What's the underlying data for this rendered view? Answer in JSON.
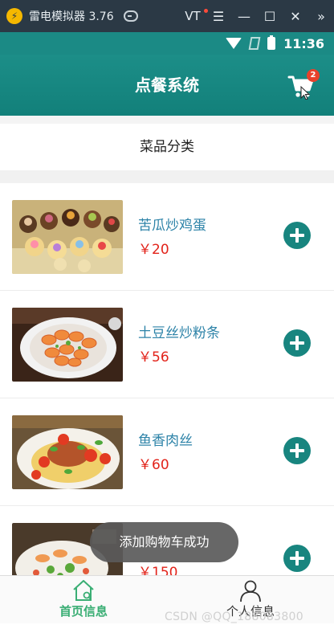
{
  "emulator": {
    "title": "雷电模拟器 3.76",
    "vt_label": "VT",
    "menu_glyph": "☰",
    "minimize_glyph": "—",
    "maximize_glyph": "☐",
    "close_glyph": "✕",
    "expand_glyph": "»"
  },
  "status_bar": {
    "time": "11:36"
  },
  "app": {
    "title": "点餐系统",
    "cart_count": "2"
  },
  "category": {
    "label": "菜品分类"
  },
  "dishes": [
    {
      "name": "苦瓜炒鸡蛋",
      "price": "￥20",
      "image": "desserts-plate"
    },
    {
      "name": "土豆丝炒粉条",
      "price": "￥56",
      "image": "shrimp-plate"
    },
    {
      "name": "鱼香肉丝",
      "price": "￥60",
      "image": "pasta-plate"
    },
    {
      "name": "",
      "price": "￥150",
      "image": "seafood-plate"
    }
  ],
  "toast": {
    "text": "添加购物车成功"
  },
  "bottom_nav": {
    "home_label": "首页信息",
    "profile_label": "个人信息"
  },
  "watermark": "CSDN @QQ_188083800",
  "colors": {
    "primary": "#1b8a85",
    "price": "#e2231a",
    "dish_name": "#2d83a8",
    "nav_active": "#3aae74",
    "badge": "#e8412b"
  }
}
